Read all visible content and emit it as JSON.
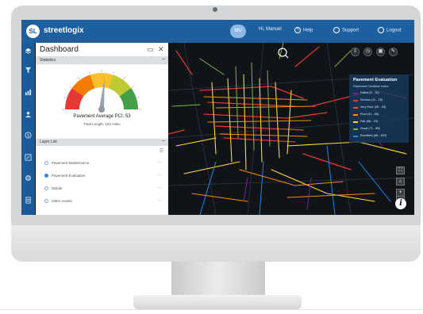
{
  "app": {
    "brand": "streetlogix",
    "logo_text": "SL"
  },
  "topbar": {
    "avatar_text": "MU",
    "greeting": "Hi, Manuel",
    "help": "Help",
    "support": "Support",
    "logout": "Logout"
  },
  "dashboard": {
    "title": "Dashboard",
    "statistics_header": "Statistics",
    "average_pci_label": "Pavement Average PCI: 53",
    "total_length_label": "Total Length: 184 miles",
    "layer_list_header": "Layer List",
    "layers": [
      {
        "label": "Pavement Maintenance",
        "active": false
      },
      {
        "label": "Pavement Evaluation",
        "active": true
      },
      {
        "label": "Mobile",
        "active": false
      },
      {
        "label": "Other Assets",
        "active": false
      }
    ],
    "gauge": {
      "value": 53,
      "min": 0,
      "max": 100,
      "colors": [
        "#e53935",
        "#f57c00",
        "#fbc02d",
        "#c0ca33",
        "#43a047"
      ]
    }
  },
  "legend": {
    "title": "Pavement Evaluation",
    "subtitle": "Pavement Condition Index",
    "items": [
      {
        "label": "Failed (0 - 10)",
        "color": "#7b1fa2"
      },
      {
        "label": "Serious (11 - 25)",
        "color": "#e53935"
      },
      {
        "label": "Very Poor (26 - 40)",
        "color": "#f4511e"
      },
      {
        "label": "Poor (41 - 55)",
        "color": "#fb8c00"
      },
      {
        "label": "Fair (56 - 70)",
        "color": "#fdd835"
      },
      {
        "label": "Good (71 - 85)",
        "color": "#7cb342"
      },
      {
        "label": "Excellent (86 - 100)",
        "color": "#1e88e5"
      }
    ]
  },
  "map_tools": {
    "zoom_in": "+",
    "zoom_out": "−",
    "info": "i"
  }
}
